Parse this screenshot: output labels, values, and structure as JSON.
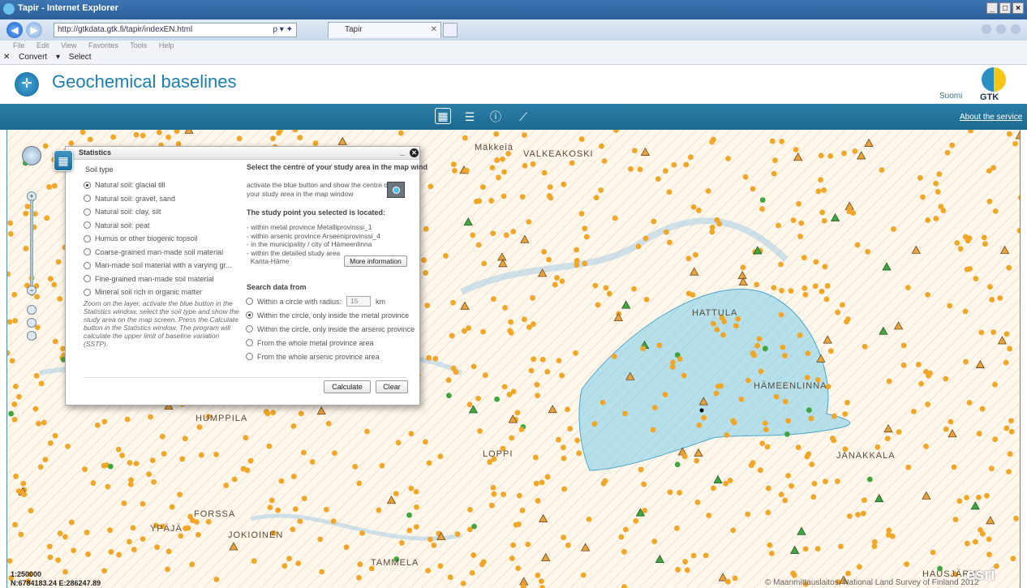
{
  "browser": {
    "window_title": "Tapir - Internet Explorer",
    "url": "http://gtkdata.gtk.fi/tapir/indexEN.html",
    "search_glyph": "ρ ▾ ✦",
    "tab_title": "Tapir",
    "menu_items": [
      "File",
      "Edit",
      "View",
      "Favorites",
      "Tools",
      "Help"
    ],
    "command_items": [
      "✕",
      "Convert",
      "▾",
      "Select"
    ],
    "window_buttons": [
      "_",
      "□",
      "×"
    ]
  },
  "app": {
    "title": "Geochemical baselines",
    "lang_link": "Suomi",
    "brand": "GTK",
    "about_link": "About the service",
    "colors": {
      "accent": "#1c6991",
      "title": "#1b7fb0"
    }
  },
  "toolbar": {
    "icons": [
      "calculator-icon",
      "list-icon",
      "info-icon",
      "measure-icon"
    ]
  },
  "map": {
    "labels": [
      "VALKEAKOSKI",
      "HATTULA",
      "HÄMEENLINNA",
      "HUMPPILA",
      "FORSSA",
      "JOKIOINEN",
      "YPÄJÄ",
      "TAMMELA",
      "JANAKKALA",
      "HAUSJÄRVI",
      "LOPPI",
      "Mäkkeiä"
    ],
    "scale": "1:250000",
    "coordinates": "N:6784183.24 E:286247.89",
    "copyright": "© Maanmittauslaitos, National Land Survey of Finland 2012",
    "esri": "esri"
  },
  "stats": {
    "title": "Statistics",
    "soil_title": "Soil type",
    "soil_types": [
      "Natural soil: glacial till",
      "Natural soil: gravel, sand",
      "Natural soil: clay, silt",
      "Natural soil: peat",
      "Humus or other biogenic topsoil",
      "Coarse-grained man-made soil material",
      "Man-made soil material with a varying gr...",
      "Fine-grained man-made soil material",
      "Mineral soil rich in organic matter"
    ],
    "soil_selected": 0,
    "help_text": "Zoom on the layer, activate the blue button in the Statistics window, select the soil type and show the study area on the map screen. Press the Calculate button in the Statistics window. The program will calculate the upper limit of baseline variation (SSTP).",
    "select_title": "Select the centre of your study area in the map wind",
    "activate_text": "activate the blue button and show the centre of your study area in the map window",
    "located_title": "The study point you selected is located:",
    "loc_lines": [
      "- within metal province  Metalliprovinssi_1",
      "- within arsenic province  Arseeniprovinssi_4",
      "- in the municipality / city of  Hämeenlinna",
      "- within the detailed study area",
      "  Kanta-Häme"
    ],
    "more_info": "More information",
    "search_title": "Search data from",
    "search_options": [
      "Within a circle with radius:",
      "Within the circle, only inside the metal province",
      "Within the circle, only inside the arsenic province",
      "From the whole metal province area",
      "From the whole arsenic province area"
    ],
    "search_selected": 1,
    "radius_value": "15",
    "radius_unit": "km",
    "calculate": "Calculate",
    "clear": "Clear"
  }
}
